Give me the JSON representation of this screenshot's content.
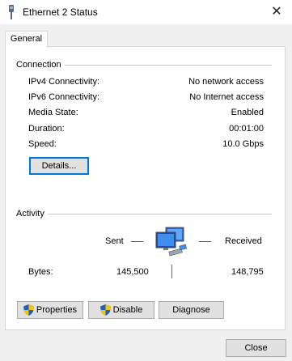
{
  "window": {
    "title": "Ethernet 2 Status",
    "close_glyph": "✕",
    "icon": "network-adapter-icon"
  },
  "tabs": [
    {
      "label": "General",
      "selected": true
    }
  ],
  "connection": {
    "group_label": "Connection",
    "rows": [
      {
        "label": "IPv4 Connectivity:",
        "value": "No network access"
      },
      {
        "label": "IPv6 Connectivity:",
        "value": "No Internet access"
      },
      {
        "label": "Media State:",
        "value": "Enabled"
      },
      {
        "label": "Duration:",
        "value": "00:01:00"
      },
      {
        "label": "Speed:",
        "value": "10.0 Gbps"
      }
    ],
    "details_button": "Details..."
  },
  "activity": {
    "group_label": "Activity",
    "sent_label": "Sent",
    "received_label": "Received",
    "bytes_label": "Bytes:",
    "bytes_sent": "145,500",
    "bytes_received": "148,795"
  },
  "actions": {
    "properties": "Properties",
    "disable": "Disable",
    "diagnose": "Diagnose"
  },
  "footer": {
    "close": "Close"
  },
  "colors": {
    "accent": "#0078d7",
    "shield_blue": "#1f5fbf",
    "shield_yellow": "#f3c500"
  }
}
